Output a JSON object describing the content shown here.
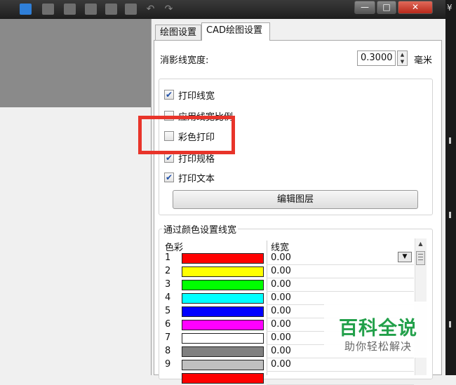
{
  "tabs": [
    {
      "label": "绘图设置",
      "active": false
    },
    {
      "label": "CAD绘图设置",
      "active": true
    }
  ],
  "line_width": {
    "label": "消影线宽度:",
    "value": "0.3000",
    "unit": "毫米"
  },
  "options": [
    {
      "label": "打印线宽",
      "checked": true
    },
    {
      "label": "应用线宽比例",
      "checked": false
    },
    {
      "label": "彩色打印",
      "checked": false
    },
    {
      "label": "打印规格",
      "checked": true
    },
    {
      "label": "打印文本",
      "checked": true
    }
  ],
  "edit_layers_label": "编辑图层",
  "color_group": {
    "title": "通过颜色设置线宽",
    "col_color": "色彩",
    "col_width": "线宽",
    "rows": [
      {
        "num": "1",
        "color": "#ff0000",
        "width": "0.00"
      },
      {
        "num": "2",
        "color": "#ffff00",
        "width": "0.00"
      },
      {
        "num": "3",
        "color": "#00ff00",
        "width": "0.00"
      },
      {
        "num": "4",
        "color": "#00ffff",
        "width": "0.00"
      },
      {
        "num": "5",
        "color": "#0000ff",
        "width": "0.00"
      },
      {
        "num": "6",
        "color": "#ff00ff",
        "width": "0.00"
      },
      {
        "num": "7",
        "color": "#ffffff",
        "width": "0.00"
      },
      {
        "num": "8",
        "color": "#808080",
        "width": "0.00"
      },
      {
        "num": "9",
        "color": "#c0c0c0",
        "width": "0.00"
      },
      {
        "num": "",
        "color": "#ff0000",
        "width": ""
      }
    ]
  },
  "window": {
    "edge_symbol": "¥",
    "close_symbol": "✕",
    "min_symbol": "—",
    "max_symbol": "□"
  },
  "watermark": {
    "title": "百科全说",
    "subtitle": "助你轻松解决"
  },
  "colors": {
    "highlight": "#e8342a",
    "watermark_green": "#22a04a"
  }
}
